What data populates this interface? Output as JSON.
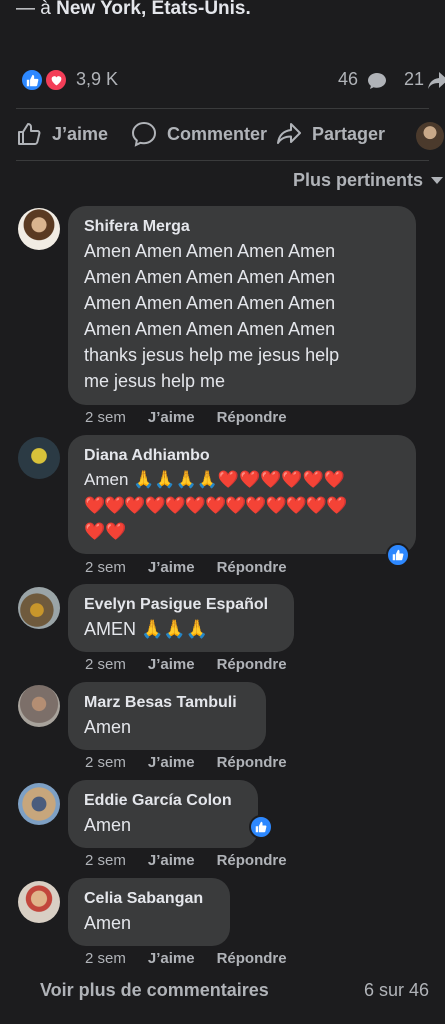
{
  "post": {
    "location_prefix": "— à",
    "location_name": "New York, États-Unis."
  },
  "stats": {
    "reactions": "3,9 K",
    "comments": "46",
    "shares": "21"
  },
  "actions": {
    "like": "J’aime",
    "comment": "Commenter",
    "share": "Partager"
  },
  "sort": {
    "label": "Plus pertinents"
  },
  "comments": [
    {
      "name": "Shifera Merga",
      "lines": [
        "Amen Amen Amen Amen Amen",
        "Amen Amen Amen Amen Amen",
        "Amen Amen Amen Amen Amen",
        "Amen Amen Amen Amen Amen",
        "thanks jesus help me jesus help",
        "me jesus help me"
      ],
      "time": "2 sem",
      "like": "J’aime",
      "reply": "Répondre"
    },
    {
      "name": "Diana Adhiambo",
      "lines": [
        "Amen 🙏🙏🙏🙏❤️❤️❤️❤️❤️❤️",
        "❤️❤️❤️❤️❤️❤️❤️❤️❤️❤️❤️❤️❤️",
        "❤️❤️"
      ],
      "time": "2 sem",
      "like": "J’aime",
      "reply": "Répondre"
    },
    {
      "name": "Evelyn Pasigue Español",
      "lines": [
        "AMEN 🙏🙏🙏"
      ],
      "time": "2 sem",
      "like": "J’aime",
      "reply": "Répondre"
    },
    {
      "name": "Marz Besas Tambuli",
      "lines": [
        "Amen"
      ],
      "time": "2 sem",
      "like": "J’aime",
      "reply": "Répondre"
    },
    {
      "name": "Eddie García Colon",
      "lines": [
        "Amen"
      ],
      "time": "2 sem",
      "like": "J’aime",
      "reply": "Répondre"
    },
    {
      "name": "Celia Sabangan",
      "lines": [
        "Amen"
      ],
      "time": "2 sem",
      "like": "J’aime",
      "reply": "Répondre"
    }
  ],
  "footer": {
    "more": "Voir plus de commentaires",
    "pager": "6 sur 46"
  },
  "colors": {
    "background": "#1c1c1e",
    "bubble": "#3a3b3c",
    "like_blue": "#2d88ff",
    "love_red": "#f33e58",
    "muted": "#b0b3b8"
  }
}
